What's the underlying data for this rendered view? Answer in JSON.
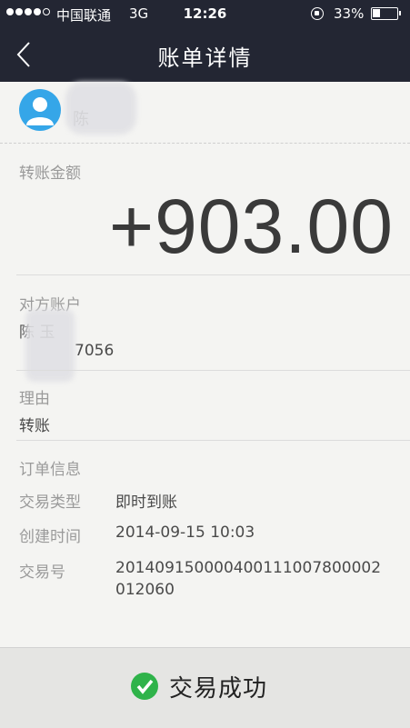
{
  "status_bar": {
    "carrier": "中国联通",
    "network": "3G",
    "time": "12:26",
    "battery": "33%"
  },
  "nav": {
    "title": "账单详情"
  },
  "payee": {
    "name": "陈"
  },
  "amount_section": {
    "label": "转账金额",
    "amount": "+903.00"
  },
  "counterparty": {
    "label": "对方账户",
    "name": "陈 玉",
    "account": "7056"
  },
  "reason": {
    "label": "理由",
    "value": "转账"
  },
  "order": {
    "title": "订单信息",
    "type_label": "交易类型",
    "type_value": "即时到账",
    "created_label": "创建时间",
    "created_value": "2014-09-15 10:03",
    "txn_label": "交易号",
    "txn_line1": "201409150000400111007800002",
    "txn_line2": "012060"
  },
  "footer": {
    "status": "交易成功"
  },
  "colors": {
    "nav_bg": "#232633",
    "avatar": "#35a6e8",
    "success": "#2fb34a"
  }
}
